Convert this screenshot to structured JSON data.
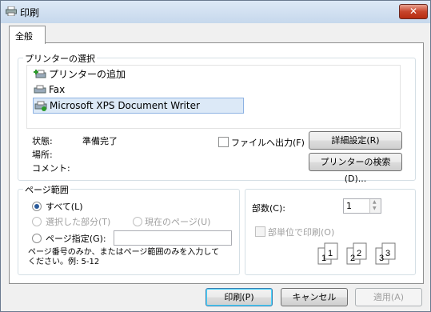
{
  "window": {
    "title": "印刷",
    "close_glyph": "✕"
  },
  "tabs": [
    {
      "label": "全般"
    }
  ],
  "printer_select": {
    "group_label": "プリンターの選択",
    "items": [
      {
        "label": "プリンターの追加",
        "icon": "add-printer-icon"
      },
      {
        "label": "Fax",
        "icon": "fax-printer-icon"
      },
      {
        "label": "Microsoft XPS Document Writer",
        "icon": "xps-printer-icon",
        "selected": true
      }
    ],
    "status_label": "状態:",
    "status_value": "準備完了",
    "location_label": "場所:",
    "comment_label": "コメント:",
    "print_to_file_label": "ファイルへ出力(F)",
    "preferences_button": "詳細設定(R)",
    "find_printer_button": "プリンターの検索(D)..."
  },
  "page_range": {
    "group_label": "ページ範囲",
    "all_label": "すべて(L)",
    "selection_label": "選択した部分(T)",
    "current_page_label": "現在のページ(U)",
    "pages_label": "ページ指定(G):",
    "pages_value": "",
    "hint": "ページ番号のみか、またはページ範囲のみを入力してください。例: 5-12"
  },
  "copies": {
    "label": "部数(C):",
    "value": "1",
    "collate_label": "部単位で印刷(O)"
  },
  "footer": {
    "print_button": "印刷(P)",
    "cancel_button": "キャンセル",
    "apply_button": "適用(A)"
  }
}
